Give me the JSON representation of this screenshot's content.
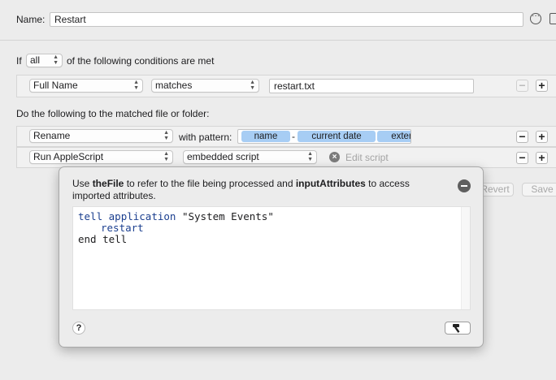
{
  "name_row": {
    "label": "Name:",
    "value": "Restart"
  },
  "conditions": {
    "prefix": "If",
    "match_mode": "all",
    "suffix": "of the following conditions are met",
    "rules": [
      {
        "attribute": "Full Name",
        "operator": "matches",
        "value": "restart.txt"
      }
    ]
  },
  "actions": {
    "heading": "Do the following to the matched file or folder:",
    "rename": {
      "action": "Rename",
      "pattern_label": "with pattern:",
      "tokens": [
        "name",
        "current date",
        "exter"
      ],
      "separator": "-"
    },
    "applescript": {
      "action": "Run AppleScript",
      "source": "embedded script",
      "edit_label": "Edit script"
    }
  },
  "footer_buttons": {
    "revert": "Revert",
    "save": "Save"
  },
  "script_popover": {
    "hint_pre": "Use ",
    "hint_var1": "theFile",
    "hint_mid": " to refer to the file being processed and ",
    "hint_var2": "inputAttributes",
    "hint_post": " to access imported attributes.",
    "code": {
      "line1_kw1": "tell",
      "line1_kw2": "application",
      "line1_str": "\"System Events\"",
      "line2": "restart",
      "line3": "end tell"
    },
    "help_label": "?"
  },
  "icons": {
    "more": "ellipsis-circle-icon",
    "doc": "document-icon",
    "clear": "clear-x-icon",
    "collapse": "minus-circle-icon",
    "compile": "hammer-icon"
  }
}
